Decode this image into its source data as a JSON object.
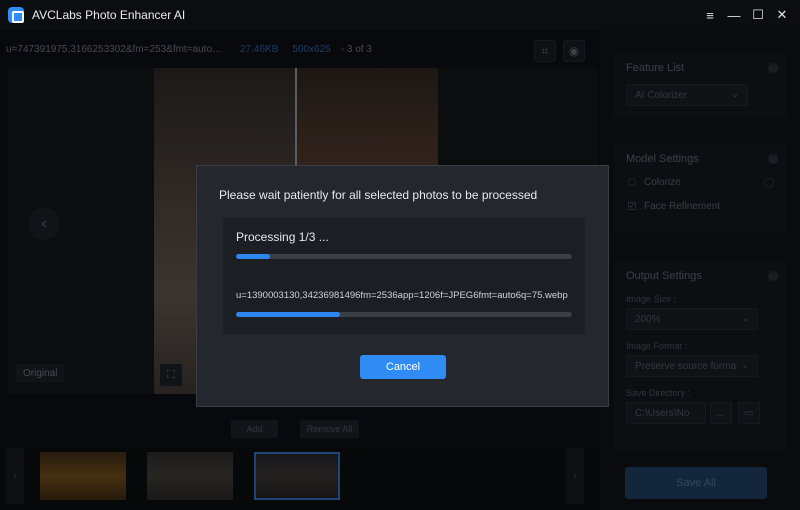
{
  "app": {
    "title": "AVCLabs Photo Enhancer AI"
  },
  "window_controls": {
    "menu": "≡",
    "minimize": "—",
    "maximize": "☐",
    "close": "✕"
  },
  "info_bar": {
    "filename": "u=747391975,3166253302&fm=253&fmt=auto&app=120...",
    "file_size": "27.46KB",
    "dimensions": "500x625",
    "count": "- 3 of 3"
  },
  "preview": {
    "badge_original": "Original"
  },
  "actions": {
    "add": "Add",
    "remove_all": "Remove All"
  },
  "right_panel": {
    "feature_list": {
      "title": "Feature List",
      "selected": "AI Colorizer"
    },
    "model_settings": {
      "title": "Model Settings",
      "options": [
        {
          "label": "Colorize",
          "checked": false
        },
        {
          "label": "Face Refinement",
          "checked": true
        }
      ]
    },
    "output_settings": {
      "title": "Output Settings",
      "image_size_label": "Image Size :",
      "image_size": "200%",
      "image_format_label": "Image Format :",
      "image_format": "Preserve source format",
      "save_dir_label": "Save Directory :",
      "save_dir": "C:\\Users\\No",
      "browse": "...",
      "folder_icon": "folder-icon"
    },
    "save_all": "Save All"
  },
  "dialog": {
    "message": "Please wait patiently for all selected photos to be processed",
    "processing": "Processing 1/3 ...",
    "overall_progress": 0.1,
    "current_file": "u=1390003130,34236981496fm=2536app=1206f=JPEG6fmt=auto6q=75.webp",
    "file_progress": 0.31,
    "cancel": "Cancel"
  },
  "colors": {
    "accent": "#2f8cf5",
    "dialog_bg": "#24272d",
    "progress_track": "#3a3e45"
  }
}
